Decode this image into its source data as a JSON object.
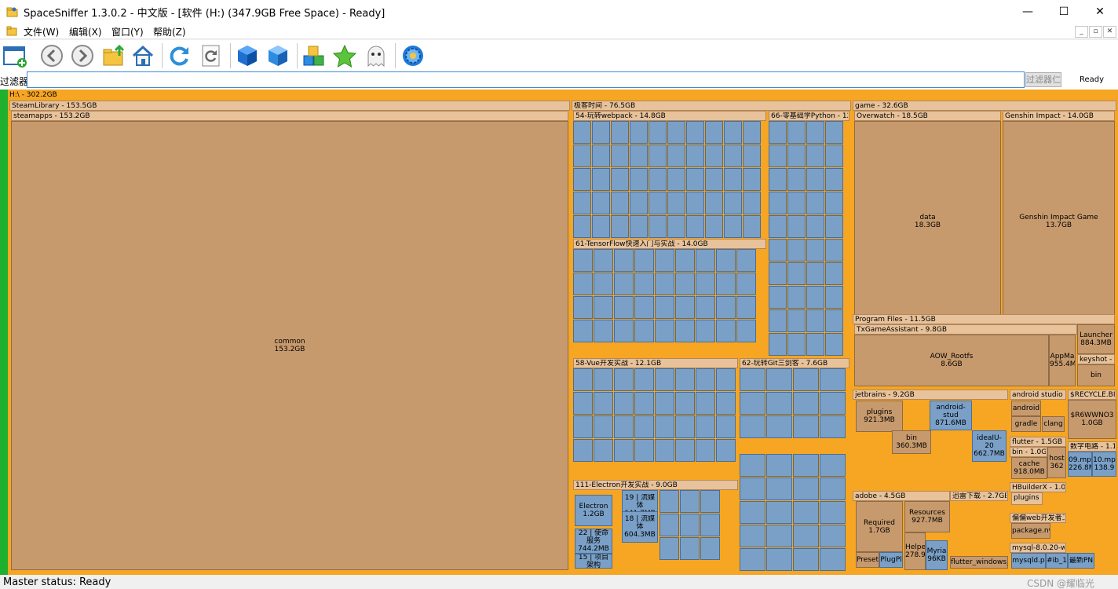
{
  "window": {
    "title": "SpaceSniffer 1.3.0.2    -    中文版    - [软件 (H:) (347.9GB Free Space) - Ready]",
    "minimize": "—",
    "maximize": "☐",
    "close": "✕"
  },
  "menu": {
    "items": [
      "文件(W)",
      "编辑(X)",
      "窗口(Y)",
      "帮助(Z)"
    ]
  },
  "toolbar": {
    "buttons": [
      "new-window",
      "back",
      "forward",
      "parent-folder",
      "home",
      "refresh",
      "refresh-all",
      "cube",
      "cube-blue",
      "cubes",
      "star",
      "ghost",
      "gear"
    ]
  },
  "filter": {
    "label": "过滤器",
    "value": "",
    "button": "过滤器仁",
    "ready": "Ready"
  },
  "map": {
    "drive": "H:\\ - 302.2GB",
    "blocks": [
      {
        "t": "SteamLibrary - 153.5GB",
        "k": "h"
      },
      {
        "t": "steamapps - 153.2GB",
        "k": "h"
      },
      {
        "t": "common\n153.2GB",
        "k": "c"
      },
      {
        "t": "极客时间 - 76.5GB",
        "k": "h"
      },
      {
        "t": "54-玩转webpack - 14.8GB",
        "k": "h"
      },
      {
        "t": "66-零基础学Python - 12.",
        "k": "h"
      },
      {
        "t": "61-TensorFlow快速入门与实战 - 14.0GB",
        "k": "h"
      },
      {
        "t": "58-Vue开发实战 - 12.1GB",
        "k": "h"
      },
      {
        "t": "62-玩转Git三剑客 - 7.6GB",
        "k": "h"
      },
      {
        "t": "111-Electron开发实战 - 9.0GB",
        "k": "h"
      },
      {
        "t": "game - 32.6GB",
        "k": "h"
      },
      {
        "t": "Overwatch - 18.5GB",
        "k": "h"
      },
      {
        "t": "data\n18.3GB",
        "k": "c"
      },
      {
        "t": "Genshin Impact - 14.0GB",
        "k": "h"
      },
      {
        "t": "Genshin Impact Game\n13.7GB",
        "k": "c"
      },
      {
        "t": "Program Files - 11.5GB",
        "k": "h"
      },
      {
        "t": "TxGameAssistant - 9.8GB",
        "k": "h"
      },
      {
        "t": "AOW_Rootfs\n8.6GB",
        "k": "c"
      },
      {
        "t": "AppMa\n955.4M",
        "k": "c"
      },
      {
        "t": "Launcher\n884.3MB",
        "k": "c"
      },
      {
        "t": "keyshot - 5",
        "k": "h"
      },
      {
        "t": "bin",
        "k": "c"
      },
      {
        "t": "jetbrains - 9.2GB",
        "k": "h"
      },
      {
        "t": "plugins\n921.3MB",
        "k": "c"
      },
      {
        "t": "android-stud\n871.6MB",
        "k": "c"
      },
      {
        "t": "bin\n360.3MB",
        "k": "c"
      },
      {
        "t": "ideaIU-20\n662.7MB",
        "k": "c"
      },
      {
        "t": "android studio - 1",
        "k": "h"
      },
      {
        "t": "android",
        "k": "c"
      },
      {
        "t": "gradle",
        "k": "c"
      },
      {
        "t": "clang",
        "k": "c"
      },
      {
        "t": "$RECYCLE.BI",
        "k": "h"
      },
      {
        "t": "$R6WWNO3\n1.0GB",
        "k": "c"
      },
      {
        "t": "flutter - 1.5GB",
        "k": "h"
      },
      {
        "t": "bin - 1.0GE",
        "k": "h"
      },
      {
        "t": "cache\n918.0MB",
        "k": "c"
      },
      {
        "t": "host\n362",
        "k": "c"
      },
      {
        "t": "数字电路 - 1.1",
        "k": "h"
      },
      {
        "t": "09.mp4\n226.8M",
        "k": "c"
      },
      {
        "t": "10.mp\n138.9",
        "k": "c"
      },
      {
        "t": "HBuilderX - 1.0GE",
        "k": "h"
      },
      {
        "t": "plugins -",
        "k": "h"
      },
      {
        "t": "adobe - 4.5GB",
        "k": "h"
      },
      {
        "t": "Required\n1.7GB",
        "k": "c"
      },
      {
        "t": "Resources\n927.7MB",
        "k": "c"
      },
      {
        "t": "Presets",
        "k": "c"
      },
      {
        "t": "PlugPl",
        "k": "c"
      },
      {
        "t": "Helpe\n278.9",
        "k": "c"
      },
      {
        "t": "Myria\n96KB",
        "k": "c"
      },
      {
        "t": "迅雷下载 - 2.7GB",
        "k": "h"
      },
      {
        "t": "flutter_windows_",
        "k": "c"
      },
      {
        "t": "偏偏web开发者工",
        "k": "h"
      },
      {
        "t": "package.nv",
        "k": "c"
      },
      {
        "t": "mysql-8.0.20-win",
        "k": "h"
      },
      {
        "t": "mysqld.p",
        "k": "c"
      },
      {
        "t": "#ib_1",
        "k": "c"
      },
      {
        "t": "最新PN",
        "k": "c"
      },
      {
        "t": "Electron\n1.2GB",
        "k": "c"
      },
      {
        "t": "22 | 使命服务\n744.2MB",
        "k": "c"
      },
      {
        "t": "15 | 项目架构",
        "k": "c"
      },
      {
        "t": "19 | 流媒体\n641.7MB",
        "k": "c"
      },
      {
        "t": "18 | 流媒体\n604.3MB",
        "k": "c"
      }
    ]
  },
  "status": {
    "text": "Master status: Ready",
    "watermark": "CSDN @耀临光"
  }
}
